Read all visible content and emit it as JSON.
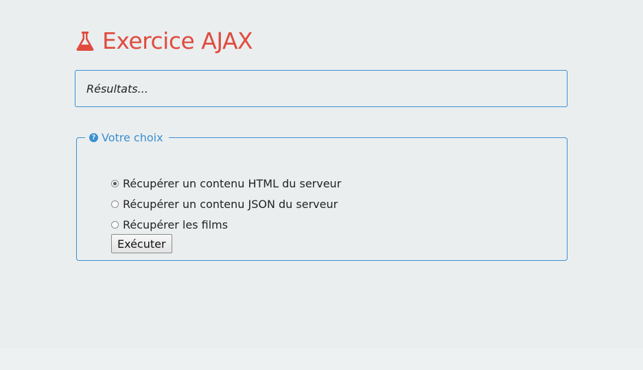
{
  "header": {
    "icon": "flask-icon",
    "title": "Exercice AJAX",
    "color": "#e04b3f"
  },
  "results": {
    "text": "Résultats..."
  },
  "choice": {
    "legend_icon": "question-circle-icon",
    "legend": "Votre choix",
    "accent": "#3a8fd0",
    "options": [
      {
        "label": "Récupérer un contenu HTML du serveur",
        "checked": true
      },
      {
        "label": "Récupérer un contenu JSON du serveur",
        "checked": false
      },
      {
        "label": "Récupérer les films",
        "checked": false
      }
    ],
    "button_label": "Exécuter"
  }
}
